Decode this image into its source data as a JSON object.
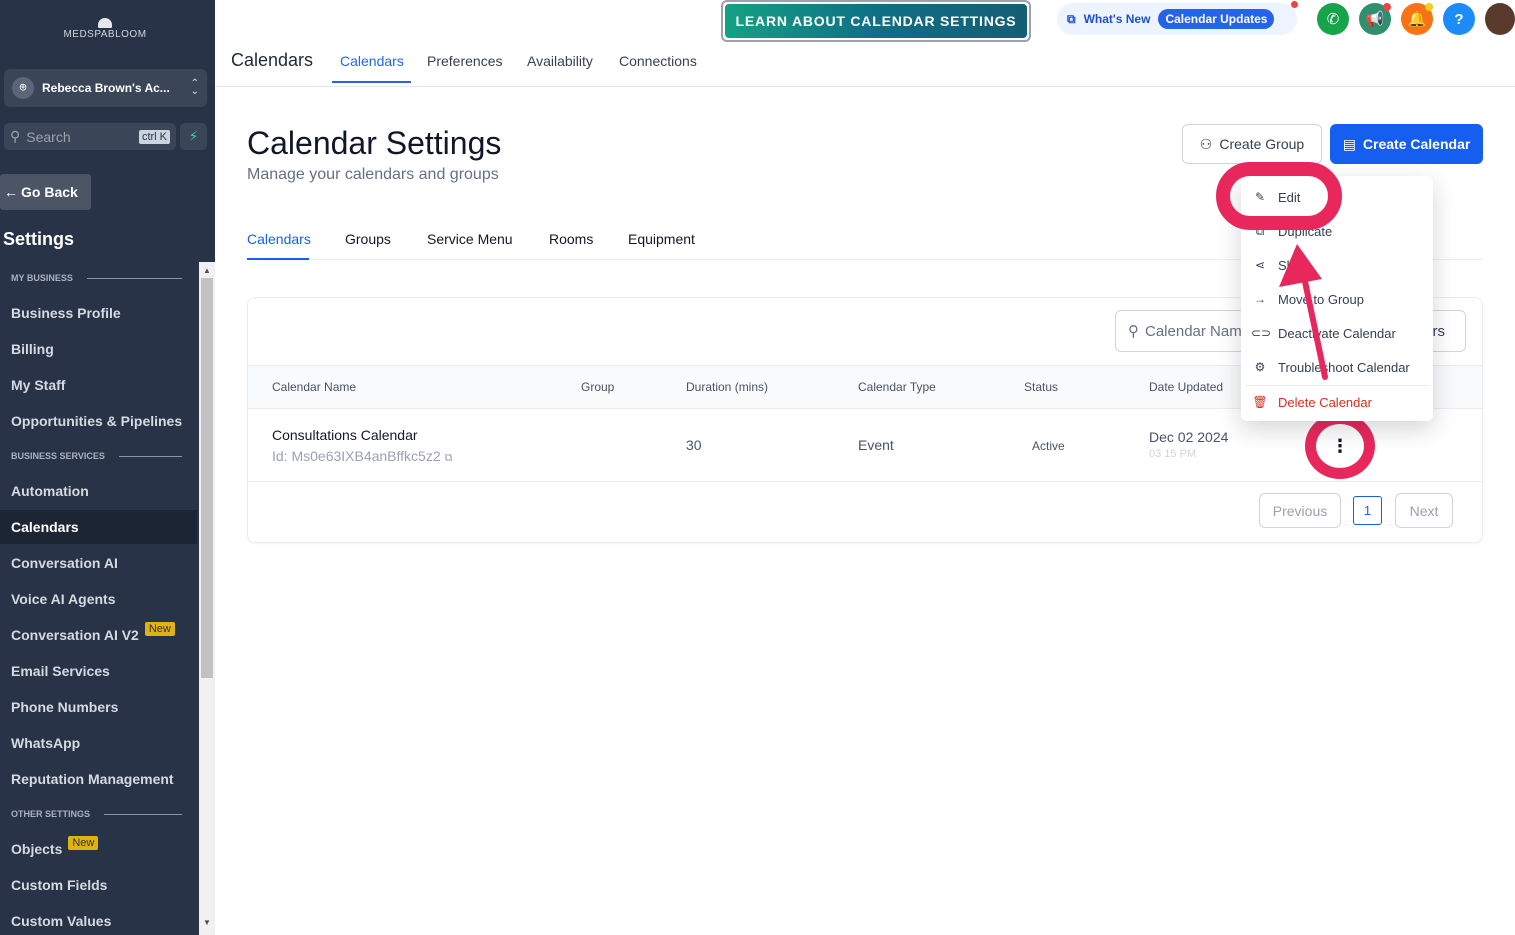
{
  "sidebar": {
    "logo": "MEDSPABLOOM",
    "account": "Rebecca Brown's Ac...",
    "search_placeholder": "Search",
    "search_shortcut": "ctrl K",
    "go_back": "Go Back",
    "settings_title": "Settings",
    "sections": {
      "my_business": "MY BUSINESS",
      "business_services": "BUSINESS SERVICES",
      "other_settings": "OTHER SETTINGS"
    },
    "items": {
      "business_profile": "Business Profile",
      "billing": "Billing",
      "my_staff": "My Staff",
      "opportunities": "Opportunities & Pipelines",
      "automation": "Automation",
      "calendars": "Calendars",
      "conversation_ai": "Conversation AI",
      "voice_ai": "Voice AI Agents",
      "conversation_ai_v2": "Conversation AI V2",
      "email_services": "Email Services",
      "phone_numbers": "Phone Numbers",
      "whatsapp": "WhatsApp",
      "reputation": "Reputation Management",
      "objects": "Objects",
      "custom_fields": "Custom Fields",
      "custom_values": "Custom Values"
    },
    "new_badge": "New"
  },
  "header": {
    "page_title": "Calendars",
    "tabs": [
      "Calendars",
      "Preferences",
      "Availability",
      "Connections"
    ],
    "learn_button": "LEARN ABOUT CALENDAR SETTINGS",
    "whats_new": "What's New",
    "calendar_updates": "Calendar Updates",
    "help": "?"
  },
  "main": {
    "title": "Calendar Settings",
    "subtitle": "Manage your calendars and groups",
    "create_group": "Create Group",
    "create_calendar": "Create Calendar",
    "subtabs": [
      "Calendars",
      "Groups",
      "Service Menu",
      "Rooms",
      "Equipment"
    ],
    "table_search_placeholder": "Calendar Nam",
    "filters_partial": "rs",
    "columns": [
      "Calendar Name",
      "Group",
      "Duration (mins)",
      "Calendar Type",
      "Status",
      "Date Updated"
    ],
    "row": {
      "name": "Consultations Calendar",
      "id": "Id: Ms0e63IXB4anBffkc5z2",
      "duration": "30",
      "type": "Event",
      "status": "Active",
      "date": "Dec 02 2024",
      "time": "03 15 PM"
    },
    "pagination": {
      "previous": "Previous",
      "page": "1",
      "next": "Next"
    }
  },
  "menu": {
    "edit": "Edit",
    "duplicate": "Duplicate",
    "share": "Sha",
    "move": "Move to Group",
    "deactivate": "Deactivate Calendar",
    "troubleshoot": "Troubleshoot Calendar",
    "delete": "Delete Calendar"
  },
  "colors": {
    "sidebar_bg": "#283347",
    "primary": "#155eef",
    "highlight": "#e8285c",
    "danger": "#d92d20"
  }
}
